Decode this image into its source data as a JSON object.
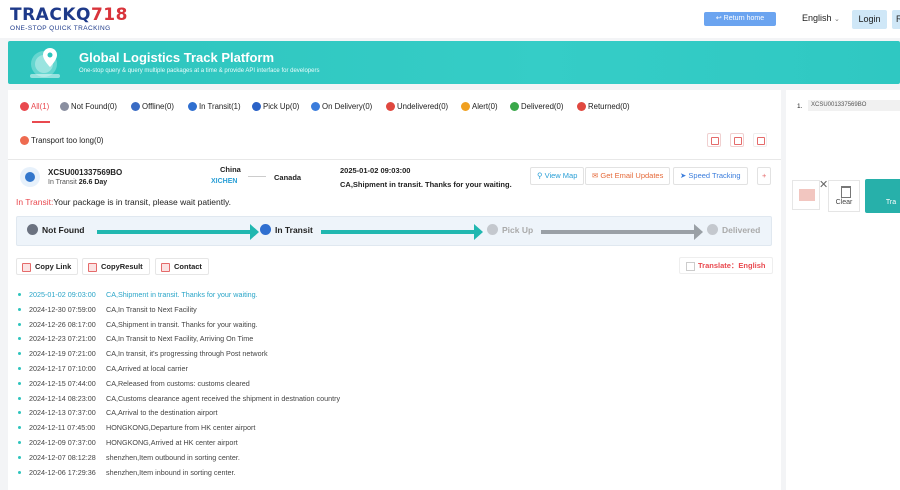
{
  "header": {
    "logo_main": "TRACKQ",
    "logo_num": "718",
    "logo_sub": "ONE-STOP QUICK TRACKING",
    "return_home": "Return home",
    "language": "English",
    "login": "Login",
    "second_btn": "R"
  },
  "banner": {
    "title": "Global Logistics Track Platform",
    "subtitle": "One-stop query & query multiple packages at a time & provide API interface for developers"
  },
  "filters": [
    {
      "label": "All(1)",
      "color": "#e9494f"
    },
    {
      "label": "Not Found(0)",
      "color": "#8a8fa0"
    },
    {
      "label": "Offline(0)",
      "color": "#3a6cc4"
    },
    {
      "label": "In Transit(1)",
      "color": "#2f6fd0"
    },
    {
      "label": "Pick Up(0)",
      "color": "#2a62c7"
    },
    {
      "label": "On Delivery(0)",
      "color": "#3b7ddc"
    },
    {
      "label": "Undelivered(0)",
      "color": "#e0483f"
    },
    {
      "label": "Alert(0)",
      "color": "#f0a020"
    },
    {
      "label": "Delivered(0)",
      "color": "#3aa84a"
    },
    {
      "label": "Returned(0)",
      "color": "#e0483f"
    },
    {
      "label": "Transport too long(0)",
      "color": "#ee6b50"
    }
  ],
  "package": {
    "number": "XCSU001337569BO",
    "status": "In Transit",
    "days": "26.6 Day",
    "origin": "China",
    "origin_sub": "XICHEN",
    "destination": "Canada",
    "last_date": "2025-01-02 09:03:00",
    "last_message": "CA,Shipment in transit. Thanks for your waiting.",
    "btn_map": "View Map",
    "btn_email": "Get Email Updates",
    "btn_speed": "Speed Tracking",
    "transit_label": "In Transit:",
    "transit_text": "Your package is in transit, please wait patiently."
  },
  "stages": [
    "Not Found",
    "In Transit",
    "Pick Up",
    "Delivered"
  ],
  "actions": {
    "copy_link": "Copy Link",
    "copy_result": "CopyResult",
    "contact": "Contact",
    "translate": "Translate：English"
  },
  "events": [
    {
      "date": "2025-01-02 09:03:00",
      "msg": "CA,Shipment in transit. Thanks for your waiting."
    },
    {
      "date": "2024-12-30 07:59:00",
      "msg": "CA,In Transit to Next Facility"
    },
    {
      "date": "2024-12-26 08:17:00",
      "msg": "CA,Shipment in transit. Thanks for your waiting."
    },
    {
      "date": "2024-12-23 07:21:00",
      "msg": "CA,In Transit to Next Facility, Arriving On Time"
    },
    {
      "date": "2024-12-19 07:21:00",
      "msg": "CA,In transit, it's progressing through Post network"
    },
    {
      "date": "2024-12-17 07:10:00",
      "msg": "CA,Arrived at local carrier"
    },
    {
      "date": "2024-12-15 07:44:00",
      "msg": "CA,Released from customs: customs cleared"
    },
    {
      "date": "2024-12-14 08:23:00",
      "msg": "CA,Customs clearance agent received the shipment in destnation country"
    },
    {
      "date": "2024-12-13 07:37:00",
      "msg": "CA,Arrival to the destination airport"
    },
    {
      "date": "2024-12-11 07:45:00",
      "msg": "HONGKONG,Departure from HK center airport"
    },
    {
      "date": "2024-12-09 07:37:00",
      "msg": "HONGKONG,Arrived at HK center airport"
    },
    {
      "date": "2024-12-07 08:12:28",
      "msg": "shenzhen,Item outbound in sorting center."
    },
    {
      "date": "2024-12-06 17:29:36",
      "msg": "shenzhen,Item inbound in sorting center."
    }
  ],
  "sidebar": {
    "index": "1.",
    "input_value": "XCSU001337569BO",
    "clear": "Clear",
    "track": "Tra"
  }
}
